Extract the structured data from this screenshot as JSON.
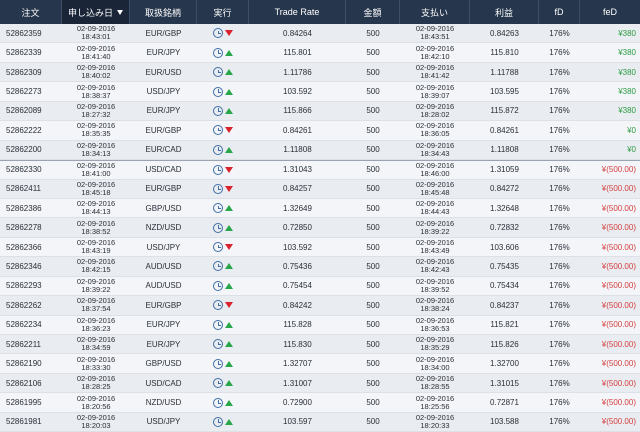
{
  "colors": {
    "header_bg": "#26364d",
    "profit": "#2c9b43",
    "loss": "#d43f3f",
    "up_arrow": "#29a64a",
    "down_arrow": "#d9232d"
  },
  "headers": [
    "注文",
    "申し込み日",
    "取扱銘柄",
    "実行",
    "Trade Rate",
    "金額",
    "支払い",
    "利益",
    "fD",
    "feD"
  ],
  "sorted_column_index": 1,
  "rows": [
    {
      "id": "52862359",
      "date": "02-09-2016",
      "time": "18:43:01",
      "pair": "EUR/GBP",
      "dir": "down",
      "rate": "0.84264",
      "amount": "500",
      "pay_date": "02-09-2016",
      "pay_time": "18:43:51",
      "profit_rate": "0.84263",
      "fd": "176%",
      "fed": "¥380",
      "result": "win"
    },
    {
      "id": "52862339",
      "date": "02-09-2016",
      "time": "18:41:40",
      "pair": "EUR/JPY",
      "dir": "up",
      "rate": "115.801",
      "amount": "500",
      "pay_date": "02-09-2016",
      "pay_time": "18:42:10",
      "profit_rate": "115.810",
      "fd": "176%",
      "fed": "¥380",
      "result": "win"
    },
    {
      "id": "52862309",
      "date": "02-09-2016",
      "time": "18:40:02",
      "pair": "EUR/USD",
      "dir": "up",
      "rate": "1.11786",
      "amount": "500",
      "pay_date": "02-09-2016",
      "pay_time": "18:41:42",
      "profit_rate": "1.11788",
      "fd": "176%",
      "fed": "¥380",
      "result": "win"
    },
    {
      "id": "52862273",
      "date": "02-09-2016",
      "time": "18:38:37",
      "pair": "USD/JPY",
      "dir": "up",
      "rate": "103.592",
      "amount": "500",
      "pay_date": "02-09-2016",
      "pay_time": "18:39:07",
      "profit_rate": "103.595",
      "fd": "176%",
      "fed": "¥380",
      "result": "win"
    },
    {
      "id": "52862089",
      "date": "02-09-2016",
      "time": "18:27:32",
      "pair": "EUR/JPY",
      "dir": "up",
      "rate": "115.866",
      "amount": "500",
      "pay_date": "02-09-2016",
      "pay_time": "18:28:02",
      "profit_rate": "115.872",
      "fd": "176%",
      "fed": "¥380",
      "result": "win"
    },
    {
      "id": "52862222",
      "date": "02-09-2016",
      "time": "18:35:35",
      "pair": "EUR/GBP",
      "dir": "down",
      "rate": "0.84261",
      "amount": "500",
      "pay_date": "02-09-2016",
      "pay_time": "18:36:05",
      "profit_rate": "0.84261",
      "fd": "176%",
      "fed": "¥0",
      "result": "win"
    },
    {
      "id": "52862200",
      "date": "02-09-2016",
      "time": "18:34:13",
      "pair": "EUR/CAD",
      "dir": "up",
      "rate": "1.11808",
      "amount": "500",
      "pay_date": "02-09-2016",
      "pay_time": "18:34:43",
      "profit_rate": "1.11808",
      "fd": "176%",
      "fed": "¥0",
      "result": "win"
    },
    {
      "id": "52862330",
      "date": "02-09-2016",
      "time": "18:41:00",
      "pair": "USD/CAD",
      "dir": "down",
      "rate": "1.31043",
      "amount": "500",
      "pay_date": "02-09-2016",
      "pay_time": "18:46:00",
      "profit_rate": "1.31059",
      "fd": "176%",
      "fed": "¥(500.00)",
      "result": "loss"
    },
    {
      "id": "52862411",
      "date": "02-09-2016",
      "time": "18:45:18",
      "pair": "EUR/GBP",
      "dir": "down",
      "rate": "0.84257",
      "amount": "500",
      "pay_date": "02-09-2016",
      "pay_time": "18:45:48",
      "profit_rate": "0.84272",
      "fd": "176%",
      "fed": "¥(500.00)",
      "result": "loss"
    },
    {
      "id": "52862386",
      "date": "02-09-2016",
      "time": "18:44:13",
      "pair": "GBP/USD",
      "dir": "up",
      "rate": "1.32649",
      "amount": "500",
      "pay_date": "02-09-2016",
      "pay_time": "18:44:43",
      "profit_rate": "1.32648",
      "fd": "176%",
      "fed": "¥(500.00)",
      "result": "loss"
    },
    {
      "id": "52862278",
      "date": "02-09-2016",
      "time": "18:38:52",
      "pair": "NZD/USD",
      "dir": "up",
      "rate": "0.72850",
      "amount": "500",
      "pay_date": "02-09-2016",
      "pay_time": "18:39:22",
      "profit_rate": "0.72832",
      "fd": "176%",
      "fed": "¥(500.00)",
      "result": "loss"
    },
    {
      "id": "52862366",
      "date": "02-09-2016",
      "time": "18:43:19",
      "pair": "USD/JPY",
      "dir": "down",
      "rate": "103.592",
      "amount": "500",
      "pay_date": "02-09-2016",
      "pay_time": "18:43:49",
      "profit_rate": "103.606",
      "fd": "176%",
      "fed": "¥(500.00)",
      "result": "loss"
    },
    {
      "id": "52862346",
      "date": "02-09-2016",
      "time": "18:42:15",
      "pair": "AUD/USD",
      "dir": "up",
      "rate": "0.75436",
      "amount": "500",
      "pay_date": "02-09-2016",
      "pay_time": "18:42:43",
      "profit_rate": "0.75435",
      "fd": "176%",
      "fed": "¥(500.00)",
      "result": "loss"
    },
    {
      "id": "52862293",
      "date": "02-09-2016",
      "time": "18:39:22",
      "pair": "AUD/USD",
      "dir": "up",
      "rate": "0.75454",
      "amount": "500",
      "pay_date": "02-09-2016",
      "pay_time": "18:39:52",
      "profit_rate": "0.75434",
      "fd": "176%",
      "fed": "¥(500.00)",
      "result": "loss"
    },
    {
      "id": "52862262",
      "date": "02-09-2016",
      "time": "18:37:54",
      "pair": "EUR/GBP",
      "dir": "down",
      "rate": "0.84242",
      "amount": "500",
      "pay_date": "02-09-2016",
      "pay_time": "18:38:24",
      "profit_rate": "0.84237",
      "fd": "176%",
      "fed": "¥(500.00)",
      "result": "loss"
    },
    {
      "id": "52862234",
      "date": "02-09-2016",
      "time": "18:36:23",
      "pair": "EUR/JPY",
      "dir": "up",
      "rate": "115.828",
      "amount": "500",
      "pay_date": "02-09-2016",
      "pay_time": "18:36:53",
      "profit_rate": "115.821",
      "fd": "176%",
      "fed": "¥(500.00)",
      "result": "loss"
    },
    {
      "id": "52862211",
      "date": "02-09-2016",
      "time": "18:34:59",
      "pair": "EUR/JPY",
      "dir": "up",
      "rate": "115.830",
      "amount": "500",
      "pay_date": "02-09-2016",
      "pay_time": "18:35:29",
      "profit_rate": "115.826",
      "fd": "176%",
      "fed": "¥(500.00)",
      "result": "loss"
    },
    {
      "id": "52862190",
      "date": "02-09-2016",
      "time": "18:33:30",
      "pair": "GBP/USD",
      "dir": "up",
      "rate": "1.32707",
      "amount": "500",
      "pay_date": "02-09-2016",
      "pay_time": "18:34:00",
      "profit_rate": "1.32700",
      "fd": "176%",
      "fed": "¥(500.00)",
      "result": "loss"
    },
    {
      "id": "52862106",
      "date": "02-09-2016",
      "time": "18:28:25",
      "pair": "USD/CAD",
      "dir": "up",
      "rate": "1.31007",
      "amount": "500",
      "pay_date": "02-09-2016",
      "pay_time": "18:28:55",
      "profit_rate": "1.31015",
      "fd": "176%",
      "fed": "¥(500.00)",
      "result": "loss"
    },
    {
      "id": "52861995",
      "date": "02-09-2016",
      "time": "18:20:56",
      "pair": "NZD/USD",
      "dir": "up",
      "rate": "0.72900",
      "amount": "500",
      "pay_date": "02-09-2016",
      "pay_time": "18:25:56",
      "profit_rate": "0.72871",
      "fd": "176%",
      "fed": "¥(500.00)",
      "result": "loss"
    },
    {
      "id": "52861981",
      "date": "02-09-2016",
      "time": "18:20:03",
      "pair": "USD/JPY",
      "dir": "up",
      "rate": "103.597",
      "amount": "500",
      "pay_date": "02-09-2016",
      "pay_time": "18:20:33",
      "profit_rate": "103.588",
      "fd": "176%",
      "fed": "¥(500.00)",
      "result": "loss"
    }
  ]
}
